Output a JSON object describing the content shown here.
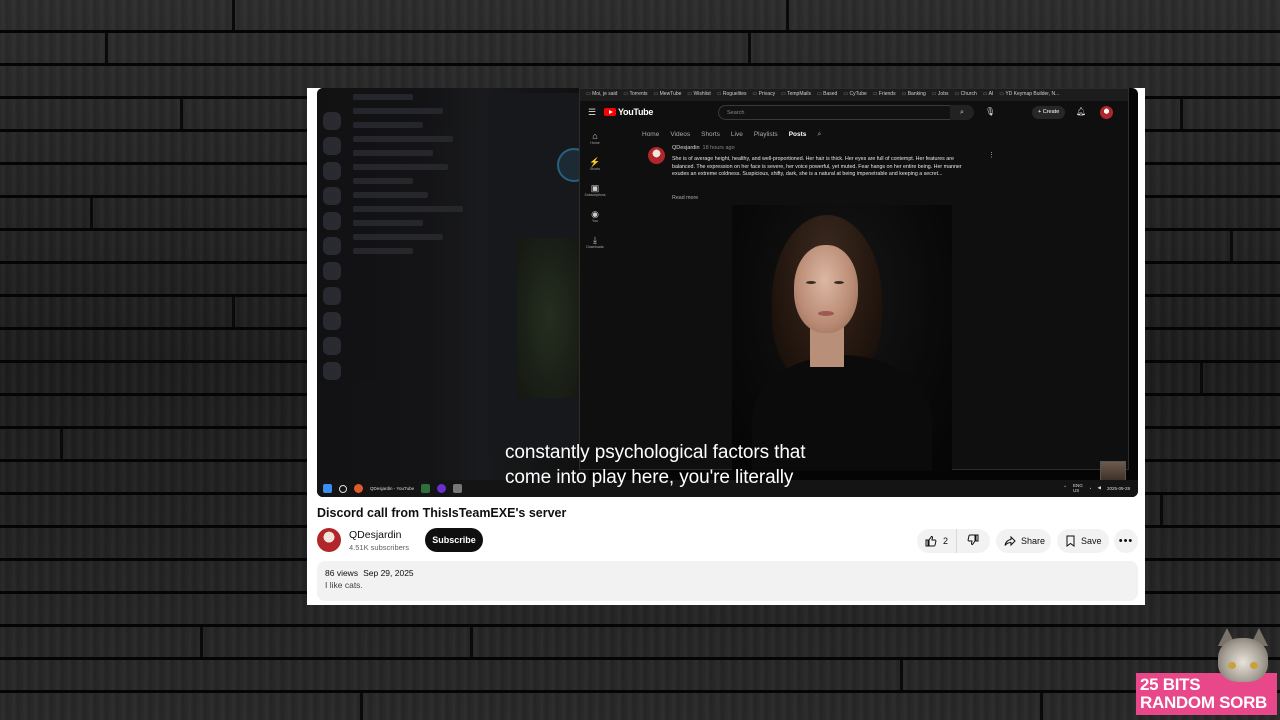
{
  "video": {
    "title": "Discord call from ThisIsTeamEXE's server",
    "caption_line1": "constantly psychological factors that",
    "caption_line2": "come into play here, you're literally"
  },
  "channel": {
    "name": "QDesjardin",
    "subscribers": "4.51K subscribers",
    "subscribe_label": "Subscribe"
  },
  "actions": {
    "likes": "2",
    "share_label": "Share",
    "save_label": "Save"
  },
  "description": {
    "views": "86 views",
    "date": "Sep 29, 2025",
    "text": "I like cats."
  },
  "inner_browser": {
    "bookmarks": [
      "Moi, je said",
      "Torrents",
      "MewTube",
      "Wishlist",
      "Roguelites",
      "Privacy",
      "TempMails",
      "Based",
      "CyTube",
      "Friends",
      "Banking",
      "Jobs",
      "Church",
      "AI",
      "YD Keymap Builder, N..."
    ],
    "logo_text": "YouTube",
    "search_placeholder": "Search",
    "create_label": "Create",
    "sidebar": [
      {
        "icon": "home-icon",
        "label": "Home"
      },
      {
        "icon": "shorts-icon",
        "label": "Shorts"
      },
      {
        "icon": "subscriptions-icon",
        "label": "Subscriptions"
      },
      {
        "icon": "you-icon",
        "label": "You"
      },
      {
        "icon": "downloads-icon",
        "label": "Downloads"
      }
    ],
    "tabs": [
      "Home",
      "Videos",
      "Shorts",
      "Live",
      "Playlists",
      "Posts"
    ],
    "active_tab": "Posts",
    "post": {
      "author": "QDesjardin",
      "time": "18 hours ago",
      "body": "She is of average height, healthy, and well-proportioned. Her hair is thick. Her eyes are full of contempt. Her features are balanced. The expression on her face is severe, her voice powerful, yet muted. Fear hangs on her entire being. Her manner exudes an extreme coldness. Suspicious, shifty, dark, she is a natural at being impenetrable and keeping a secret...",
      "read_more": "Read more"
    },
    "taskbar": {
      "app_label": "QDesjardin - YouTube",
      "lang": "ENG",
      "region": "US",
      "date": "2025-09-28"
    }
  },
  "brand": {
    "line1": "25 BITS",
    "line2": "RANDOM SORB"
  },
  "colors": {
    "youtube_red": "#ff0000",
    "brand_pink": "#e8478a",
    "subscribe_bg": "#0f0f0f"
  }
}
